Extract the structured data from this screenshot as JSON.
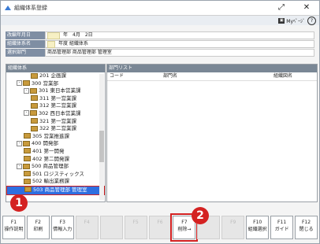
{
  "window": {
    "title": "組織体系登録"
  },
  "window_buttons": {
    "expand": "⤢",
    "close": "✕"
  },
  "toolbar": {
    "mypage_label": "Myﾍﾟｰｼﾞ",
    "help": "?"
  },
  "info": {
    "rows": [
      {
        "label": "改編年月日",
        "value": "年　4月　2日"
      },
      {
        "label": "組織体系名",
        "value": "年度 組織体系"
      },
      {
        "label": "選択部門",
        "value": "商品管理部 商品管理部 管理室"
      }
    ]
  },
  "left_panel": {
    "header": "組織体系",
    "tree": [
      {
        "label": "201 企画課",
        "indent": 3,
        "toggle": ""
      },
      {
        "label": "300 営業部",
        "indent": 1,
        "toggle": "-"
      },
      {
        "label": "301 東日本営業課",
        "indent": 2,
        "toggle": "-"
      },
      {
        "label": "311 第一営業課",
        "indent": 3,
        "toggle": ""
      },
      {
        "label": "312 第二営業課",
        "indent": 3,
        "toggle": ""
      },
      {
        "label": "302 西日本営業課",
        "indent": 2,
        "toggle": "-"
      },
      {
        "label": "321 第一営業課",
        "indent": 3,
        "toggle": ""
      },
      {
        "label": "322 第二営業課",
        "indent": 3,
        "toggle": ""
      },
      {
        "label": "305 営業推進課",
        "indent": 2,
        "toggle": ""
      },
      {
        "label": "400 開発部",
        "indent": 1,
        "toggle": "-"
      },
      {
        "label": "401 第一開発",
        "indent": 2,
        "toggle": ""
      },
      {
        "label": "402 第二開発課",
        "indent": 2,
        "toggle": ""
      },
      {
        "label": "500 商品管理部",
        "indent": 1,
        "toggle": "-"
      },
      {
        "label": "501 ロジスティックス",
        "indent": 2,
        "toggle": ""
      },
      {
        "label": "502 輸出業務課",
        "indent": 2,
        "toggle": ""
      },
      {
        "label": "503 商品管理部 管理室",
        "indent": 2,
        "toggle": "",
        "selected": true
      }
    ]
  },
  "right_panel": {
    "header": "部門リスト",
    "columns": [
      "コード",
      "部門名",
      "組織図名"
    ]
  },
  "annotations": {
    "badge1": "1",
    "badge2": "2"
  },
  "fkeys": [
    {
      "key": "F1",
      "label": "操作説明",
      "enabled": true
    },
    {
      "key": "F2",
      "label": "印刷",
      "enabled": true
    },
    {
      "key": "F3",
      "label": "情報入力",
      "enabled": true
    },
    {
      "key": "F4",
      "label": "",
      "enabled": false
    },
    {
      "key": "",
      "label": "",
      "enabled": false
    },
    {
      "key": "F5",
      "label": "",
      "enabled": false
    },
    {
      "key": "F6",
      "label": "",
      "enabled": false
    },
    {
      "key": "F7",
      "label": "削除→",
      "enabled": true,
      "highlight": true
    },
    {
      "key": "",
      "label": "",
      "enabled": false
    },
    {
      "key": "F9",
      "label": "",
      "enabled": false
    },
    {
      "key": "F10",
      "label": "組織選択",
      "enabled": true
    },
    {
      "key": "F11",
      "label": "ガイド",
      "enabled": true
    },
    {
      "key": "F12",
      "label": "閉じる",
      "enabled": true
    }
  ]
}
